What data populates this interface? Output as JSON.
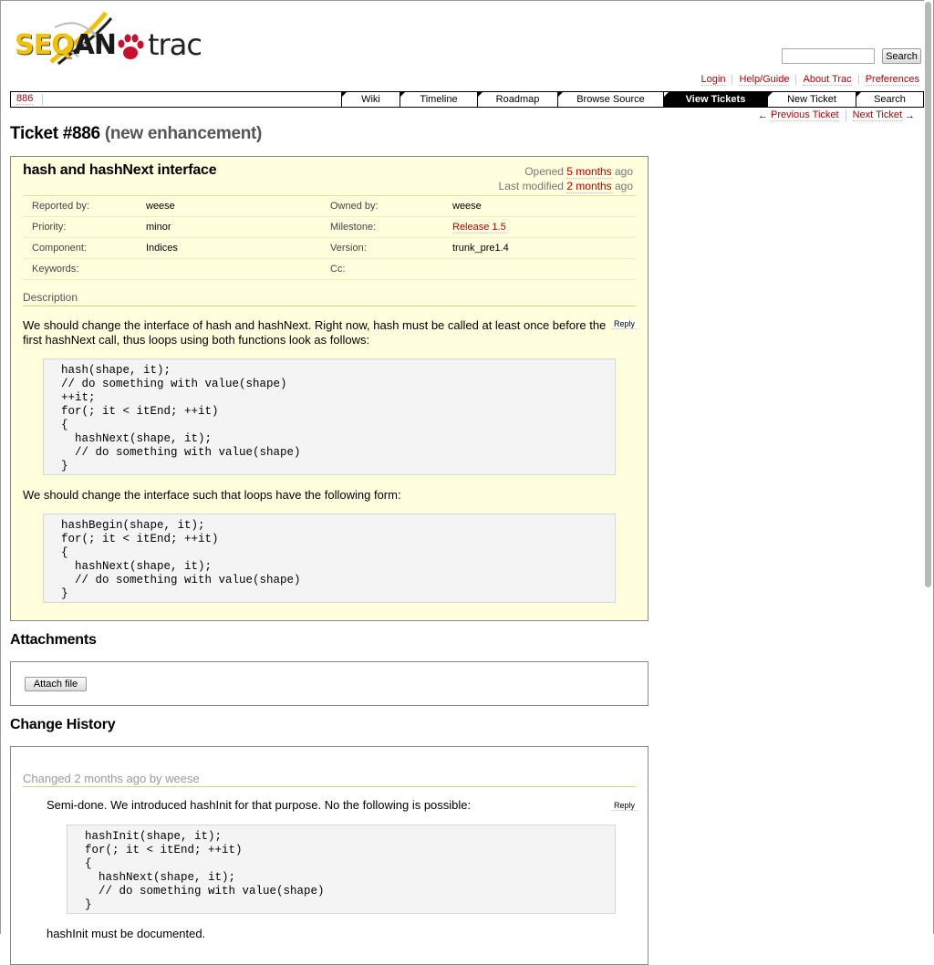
{
  "logo": {
    "seq": "SEQ",
    "an": "AN",
    "trac": "trac"
  },
  "search": {
    "placeholder": "",
    "button_label": "Search"
  },
  "metanav": [
    "Login",
    "Help/Guide",
    "About Trac",
    "Preferences"
  ],
  "context_nav": "886",
  "mainnav": [
    {
      "label": "Wiki",
      "width": 64
    },
    {
      "label": "Timeline",
      "width": 85
    },
    {
      "label": "Roadmap",
      "width": 88
    },
    {
      "label": "Browse Source",
      "width": 116
    },
    {
      "label": "View Tickets",
      "width": 114,
      "active": true
    },
    {
      "label": "New Ticket",
      "width": 97
    },
    {
      "label": "Search",
      "width": 74
    }
  ],
  "ticketnav": {
    "prev_arrow": "←",
    "prev_label": "Previous Ticket",
    "next_label": "Next Ticket",
    "next_arrow": "→"
  },
  "title": {
    "ticket": "Ticket #886",
    "status": "(new enhancement)"
  },
  "ticket": {
    "summary": "hash and hashNext interface",
    "opened_prefix": "Opened",
    "opened_link": "5 months",
    "opened_suffix": "ago",
    "modified_prefix": "Last modified",
    "modified_link": "2 months",
    "modified_suffix": "ago",
    "props": [
      {
        "l1": "Reported by:",
        "v1": "weese",
        "l2": "Owned by:",
        "v2": "weese",
        "v2link": false
      },
      {
        "l1": "Priority:",
        "v1": "minor",
        "l2": "Milestone:",
        "v2": "Release 1.5",
        "v2link": true
      },
      {
        "l1": "Component:",
        "v1": "Indices",
        "l2": "Version:",
        "v2": "trunk_pre1.4",
        "v2link": false
      },
      {
        "l1": "Keywords:",
        "v1": "",
        "l2": "Cc:",
        "v2": "",
        "v2link": false
      }
    ],
    "description_heading": "Description",
    "reply_label": "Reply",
    "desc_para1": "We should change the interface of hash and hashNext. Right now, hash must be called at least once before the first hashNext call, thus loops using both functions look as follows:",
    "desc_code1": "hash(shape, it);\n// do something with value(shape)\n++it;\nfor(; it < itEnd; ++it)\n{\n  hashNext(shape, it);\n  // do something with value(shape)\n}",
    "desc_para2": "We should change the interface such that loops have the following form:",
    "desc_code2": "hashBegin(shape, it);\nfor(; it < itEnd; ++it)\n{\n  hashNext(shape, it);\n  // do something with value(shape)\n}"
  },
  "attachments": {
    "title": "Attachments",
    "button_label": "Attach file"
  },
  "history": {
    "title": "Change History",
    "changes": [
      {
        "prefix": "Changed",
        "time_link": "2 months ago",
        "by": "by weese",
        "comment": "Semi-done. We introduced hashInit for that purpose. No the following is possible:",
        "code": "hashInit(shape, it);\nfor(; it < itEnd; ++it)\n{\n  hashNext(shape, it);\n  // do something with value(shape)\n}",
        "after": "hashInit must be documented."
      }
    ]
  }
}
